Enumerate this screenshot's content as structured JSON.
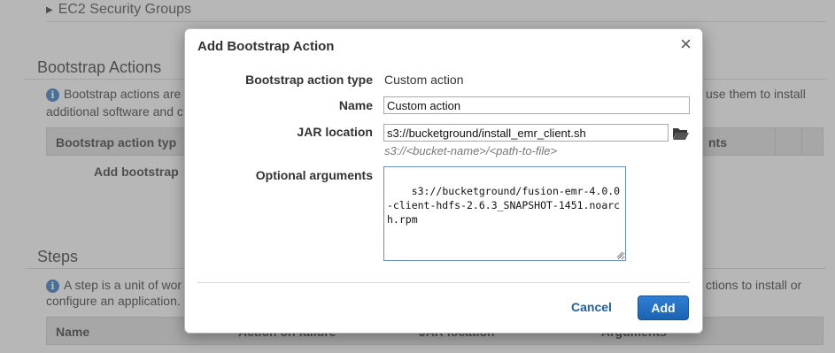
{
  "background": {
    "ec2_group": "EC2 Security Groups",
    "bootstrap": {
      "title": "Bootstrap Actions",
      "info_left": "Bootstrap actions are",
      "info_right": "use them to install",
      "info_line2": "additional software and c",
      "col1": "Bootstrap action typ",
      "col_right": "nts",
      "add_text": "Add bootstrap"
    },
    "steps": {
      "title": "Steps",
      "info_left": "A step is a unit of wor",
      "info_right": "ctions to install or",
      "info_line2": "configure an application.",
      "col1": "Name",
      "col2": "Action on failure",
      "col3": "JAR location",
      "col4": "Arguments"
    }
  },
  "dialog": {
    "title": "Add Bootstrap Action",
    "close_glyph": "×",
    "type_label": "Bootstrap action type",
    "type_value": "Custom action",
    "name_label": "Name",
    "name_value": "Custom action",
    "jar_label": "JAR location",
    "jar_value": "s3://bucketground/install_emr_client.sh",
    "jar_hint": "s3://<bucket-name>/<path-to-file>",
    "args_label": "Optional arguments",
    "args_value": "s3://bucketground/fusion-emr-4.0.0-client-hdfs-2.6.3_SNAPSHOT-1451.noarch.rpm",
    "cancel_label": "Cancel",
    "add_label": "Add"
  },
  "icons": {
    "info": "info-icon",
    "folder": "folder-open-icon",
    "close": "close-icon",
    "expand": "triangle-right-icon"
  },
  "colors": {
    "primary_button": "#1f6fc4",
    "link": "#1f5fa6",
    "info_icon": "#2f6fb5"
  }
}
